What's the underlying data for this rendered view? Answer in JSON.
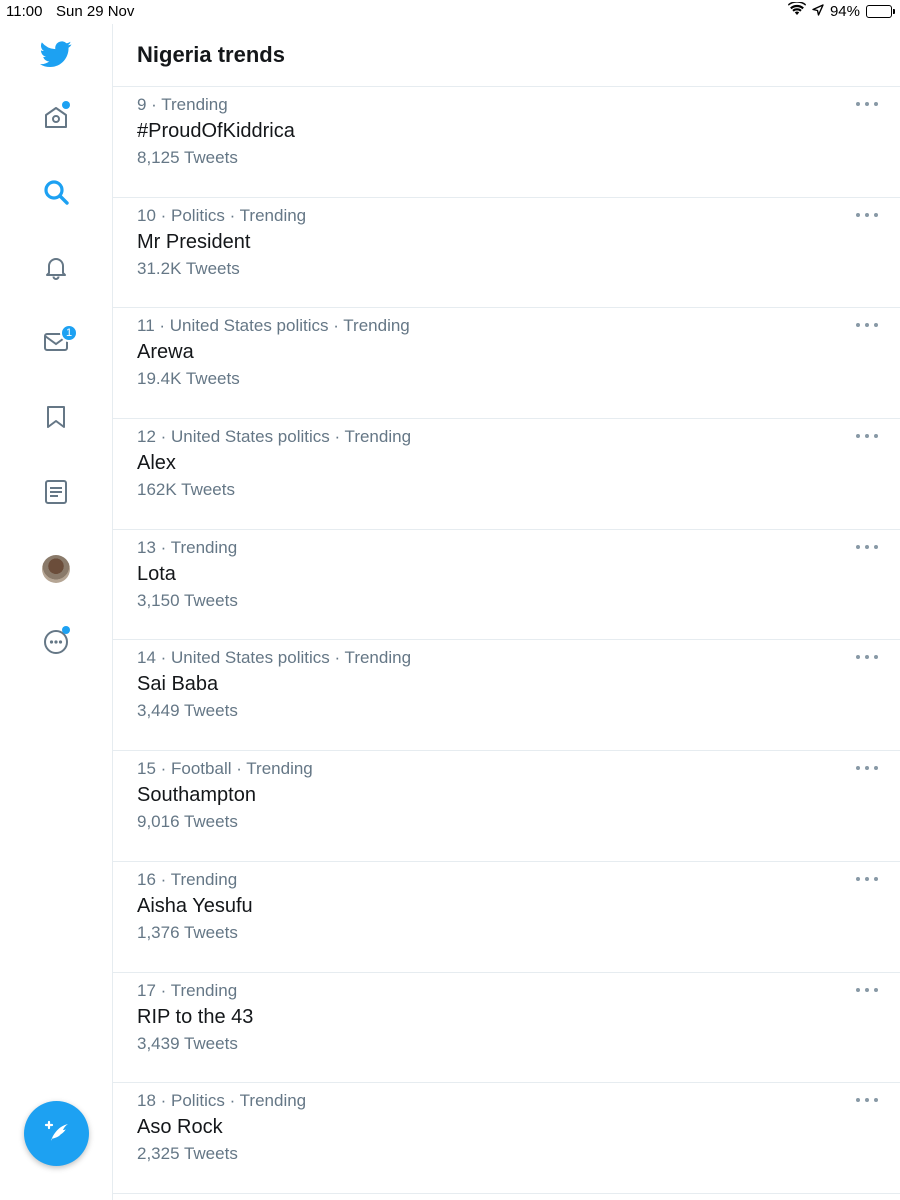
{
  "status_bar": {
    "time": "11:00",
    "date": "Sun 29 Nov",
    "battery": "94%",
    "battery_level": 0.94
  },
  "sidebar": {
    "items": [
      {
        "name": "home",
        "icon": "home-icon",
        "has_dot": true
      },
      {
        "name": "explore",
        "icon": "search-icon",
        "active": true
      },
      {
        "name": "notifications",
        "icon": "bell-icon"
      },
      {
        "name": "messages",
        "icon": "mail-icon",
        "badge": "1"
      },
      {
        "name": "bookmarks",
        "icon": "bookmark-icon"
      },
      {
        "name": "lists",
        "icon": "list-icon"
      },
      {
        "name": "profile",
        "icon": "avatar"
      },
      {
        "name": "more",
        "icon": "more-circle-icon",
        "has_dot": true
      }
    ],
    "compose_icon": "compose-feather-icon"
  },
  "header": {
    "title": "Nigeria trends"
  },
  "trends": [
    {
      "meta": "9 · Trending",
      "name": "#ProudOfKiddrica",
      "count": "8,125 Tweets"
    },
    {
      "meta": "10 · Politics · Trending",
      "name": "Mr President",
      "count": "31.2K Tweets"
    },
    {
      "meta": "11 · United States politics · Trending",
      "name": "Arewa",
      "count": "19.4K Tweets"
    },
    {
      "meta": "12 · United States politics · Trending",
      "name": "Alex",
      "count": "162K Tweets"
    },
    {
      "meta": "13 · Trending",
      "name": "Lota",
      "count": "3,150 Tweets"
    },
    {
      "meta": "14 · United States politics · Trending",
      "name": "Sai Baba",
      "count": "3,449 Tweets"
    },
    {
      "meta": "15 · Football · Trending",
      "name": "Southampton",
      "count": "9,016 Tweets"
    },
    {
      "meta": "16 · Trending",
      "name": "Aisha Yesufu",
      "count": "1,376 Tweets"
    },
    {
      "meta": "17 · Trending",
      "name": "RIP to the 43",
      "count": "3,439 Tweets"
    },
    {
      "meta": "18 · Politics · Trending",
      "name": "Aso Rock",
      "count": "2,325 Tweets"
    }
  ],
  "colors": {
    "accent": "#1da1f2",
    "text_primary": "#14171a",
    "text_secondary": "#657786",
    "divider": "#e6ecf0"
  }
}
